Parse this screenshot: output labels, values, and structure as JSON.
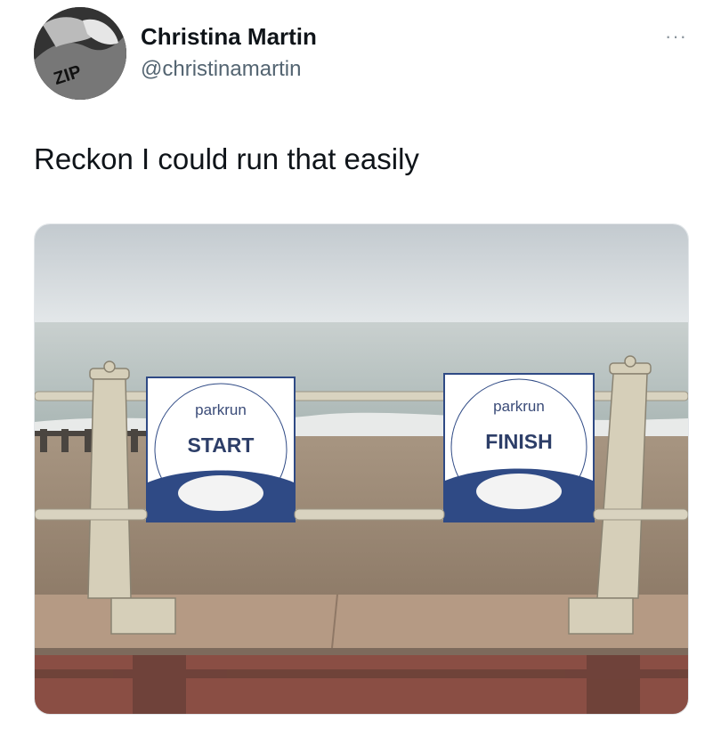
{
  "user": {
    "name": "Christina Martin",
    "handle": "@christinamartin",
    "avatar_text": "ZIP"
  },
  "menu": {
    "more_icon": "more-horizontal-icon",
    "glyph": "···"
  },
  "tweet": {
    "text": "Reckon I could run that easily"
  },
  "photo": {
    "signs": [
      {
        "brand": "parkrun",
        "label": "START"
      },
      {
        "brand": "parkrun",
        "label": "FINISH"
      }
    ]
  },
  "colors": {
    "sky": "#cfd6da",
    "sea": "#b9c4c4",
    "shingle": "#9d8a75",
    "sign_blue": "#2f4a85",
    "rail": "#d8d2bf"
  }
}
